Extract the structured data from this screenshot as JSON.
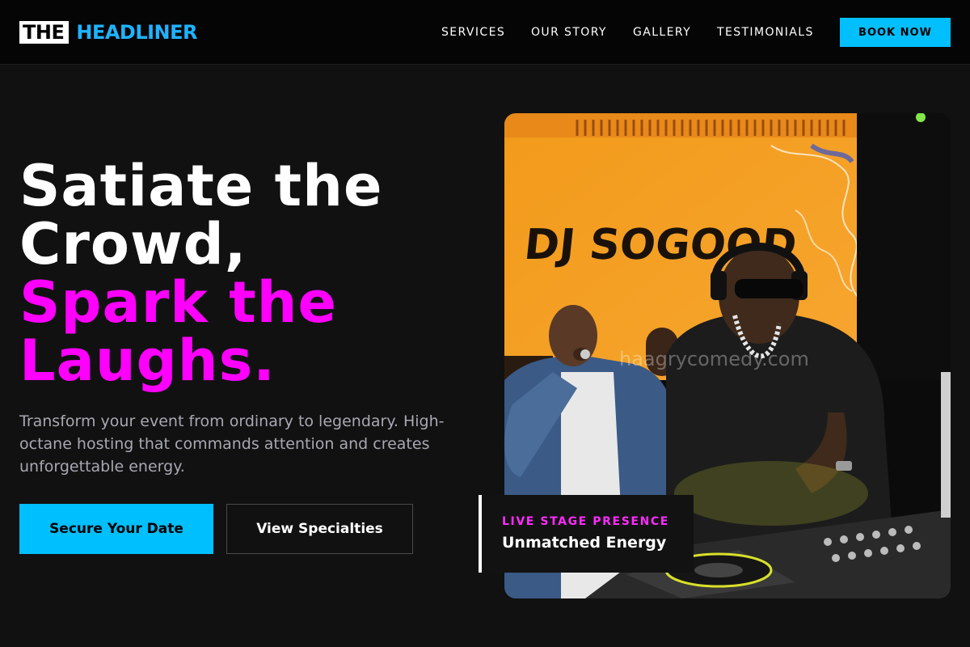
{
  "header": {
    "logo_box": "THE",
    "logo_word": "HEADLINER",
    "nav": [
      "SERVICES",
      "OUR STORY",
      "GALLERY",
      "TESTIMONIALS"
    ],
    "cta": "BOOK NOW"
  },
  "hero": {
    "headline_line1": "Satiate the",
    "headline_line2": "Crowd,",
    "headline_line3": "Spark the",
    "headline_line4": "Laughs.",
    "subtext": "Transform your event from ordinary to legendary. High-octane hosting that commands attention and creates unforgettable energy.",
    "primary_button": "Secure Your Date",
    "secondary_button": "View Specialties"
  },
  "photo": {
    "screen_text": "DJ SOGOOD",
    "watermark": "haagrycomedy.com"
  },
  "badge": {
    "kicker": "LIVE STAGE PRESENCE",
    "title": "Unmatched Energy"
  },
  "colors": {
    "accent_cyan": "#00bfff",
    "accent_magenta": "#ff00ff",
    "background": "#111111"
  }
}
